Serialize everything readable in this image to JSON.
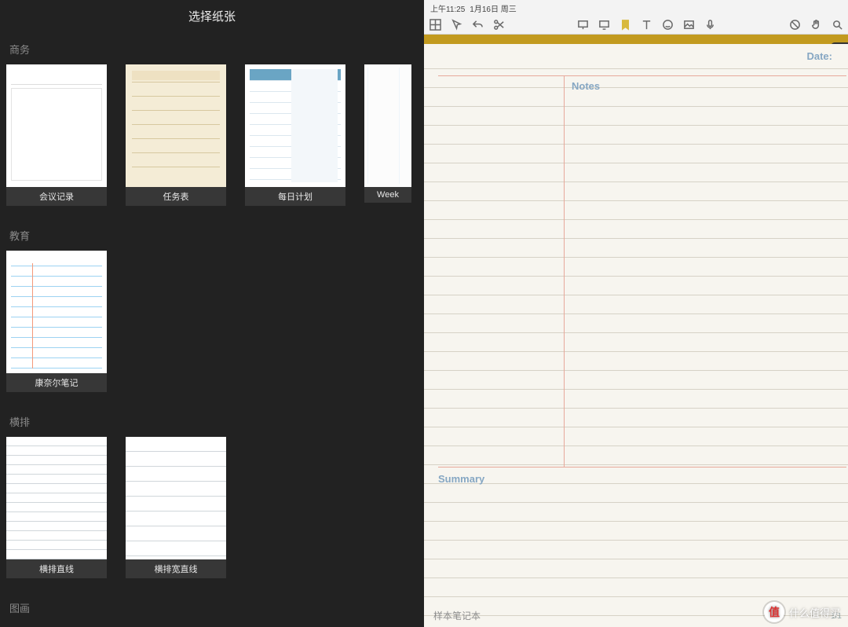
{
  "panel": {
    "title": "选择纸张",
    "categories": [
      {
        "label": "商务",
        "templates": [
          {
            "name": "会议记录",
            "thumb_class": "tm-meeting"
          },
          {
            "name": "任务表",
            "thumb_class": "tm-task"
          },
          {
            "name": "每日计划",
            "thumb_class": "tm-daily"
          },
          {
            "name": "Week",
            "thumb_class": "tm-week"
          }
        ]
      },
      {
        "label": "教育",
        "templates": [
          {
            "name": "康奈尔笔记",
            "thumb_class": "tm-cornell"
          }
        ]
      },
      {
        "label": "横排",
        "templates": [
          {
            "name": "横排直线",
            "thumb_class": "tm-ruled"
          },
          {
            "name": "横排宽直线",
            "thumb_class": "tm-ruled-wide"
          }
        ]
      },
      {
        "label": "图画",
        "templates": []
      }
    ]
  },
  "status": {
    "time": "上午11:25",
    "date": "1月16日 周三"
  },
  "toolbar_icons": {
    "grid": "grid-icon",
    "laser": "pointer-icon",
    "undo": "undo-icon",
    "cut": "scissors-icon",
    "shape1": "present-icon",
    "shape2": "present2-icon",
    "bookmark": "bookmark-icon",
    "text": "text-icon",
    "emoji": "emoji-icon",
    "image": "image-icon",
    "mic": "mic-icon",
    "nodraw": "disable-icon",
    "hand": "hand-icon",
    "search": "search-icon"
  },
  "page": {
    "date_label": "Date:",
    "notes_label": "Notes",
    "summary_label": "Summary",
    "notebook_name": "样本笔记本",
    "page_indicator": "1/1"
  },
  "watermark": {
    "badge": "值",
    "text": "什么值得买"
  },
  "colors": {
    "accent_yellow": "#c29a1f",
    "label_blue": "#86a7c3",
    "rule_pink": "#e7a89a"
  }
}
